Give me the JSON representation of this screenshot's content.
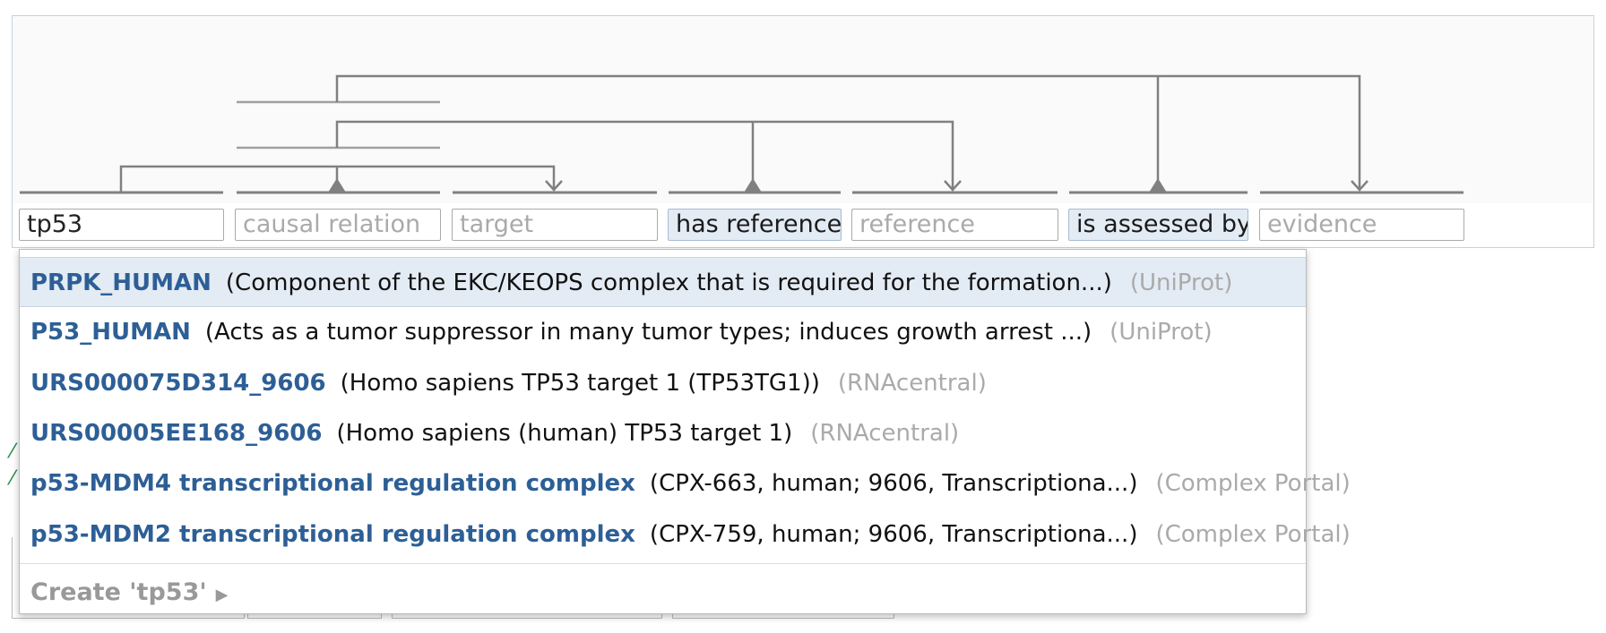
{
  "relation_editor": {
    "fields": [
      {
        "value": "tp53",
        "placeholder": "",
        "kind": "input"
      },
      {
        "value": "",
        "placeholder": "causal relation",
        "kind": "input"
      },
      {
        "value": "",
        "placeholder": "target",
        "kind": "input"
      },
      {
        "value": "has reference",
        "placeholder": "",
        "kind": "relation"
      },
      {
        "value": "",
        "placeholder": "reference",
        "kind": "input"
      },
      {
        "value": "is assessed by",
        "placeholder": "",
        "kind": "relation"
      },
      {
        "value": "",
        "placeholder": "evidence",
        "kind": "input"
      }
    ]
  },
  "autocomplete": {
    "options": [
      {
        "name": "PRPK_HUMAN",
        "description": "(Component of the EKC/KEOPS complex that is required for the formation...)",
        "source": "(UniProt)"
      },
      {
        "name": "P53_HUMAN",
        "description": "(Acts as a tumor suppressor in many tumor types; induces growth arrest ...)",
        "source": "(UniProt)"
      },
      {
        "name": "URS000075D314_9606",
        "description": "(Homo sapiens TP53 target 1 (TP53TG1))",
        "source": "(RNAcentral)"
      },
      {
        "name": "URS00005EE168_9606",
        "description": "(Homo sapiens (human) TP53 target 1)",
        "source": "(RNAcentral)"
      },
      {
        "name": "p53-MDM4 transcriptional regulation complex",
        "description": "(CPX-663, human; 9606, Transcriptiona...)",
        "source": "(Complex Portal)"
      },
      {
        "name": "p53-MDM2 transcriptional regulation complex",
        "description": "(CPX-759, human; 9606, Transcriptiona...)",
        "source": "(Complex Portal)"
      }
    ],
    "create_label": "Create 'tp53'",
    "create_arrow": "▶"
  },
  "colors": {
    "accent_link": "#2d5f96",
    "highlight": "#e3ebf4",
    "connector": "#808080"
  }
}
